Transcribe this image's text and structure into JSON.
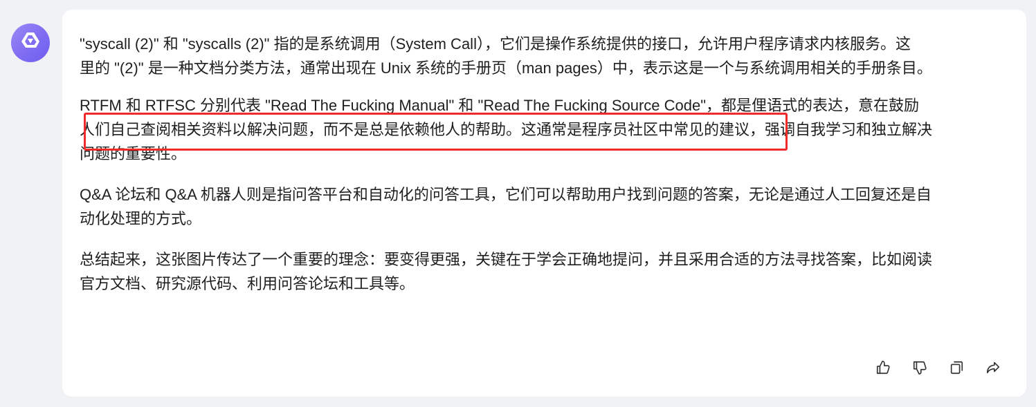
{
  "assistant": {
    "avatar_icon": "assistant-logo-icon",
    "accent_color": "#7e6cf2"
  },
  "message": {
    "lines": [
      "\"syscall (2)\" 和 \"syscalls (2)\" 指的是系统调用（System Call），它们是操作系统提供的接口，允许用户程序请求内核服务。这",
      "里的 \"(2)\" 是一种文档分类方法，通常出现在 Unix 系统的手册页（man pages）中，表示这是一个与系统调用相关的手册条目。",
      "RTFM 和 RTFSC 分别代表 \"Read The Fucking Manual\" 和 \"Read The Fucking Source Code\"，都是俚语式的表达，意在鼓励",
      "人们自己查阅相关资料以解决问题，而不是总是依赖他人的帮助。这通常是程序员社区中常见的建议，强调自我学习和独立解决",
      "问题的重要性。",
      "Q&A 论坛和 Q&A 机器人则是指问答平台和自动化的问答工具，它们可以帮助用户找到问题的答案，无论是通过人工回复还是自",
      "动化处理的方式。",
      "总结起来，这张图片传达了一个重要的理念：要变得更强，关键在于学会正确地提问，并且采用合适的方法寻找答案，比如阅读",
      "官方文档、研究源代码、利用问答论坛和工具等。"
    ],
    "highlight_color": "#f02a2a"
  },
  "actions": {
    "like_icon": "thumbs-up-icon",
    "dislike_icon": "thumbs-down-icon",
    "copy_icon": "copy-icon",
    "share_icon": "share-icon"
  }
}
